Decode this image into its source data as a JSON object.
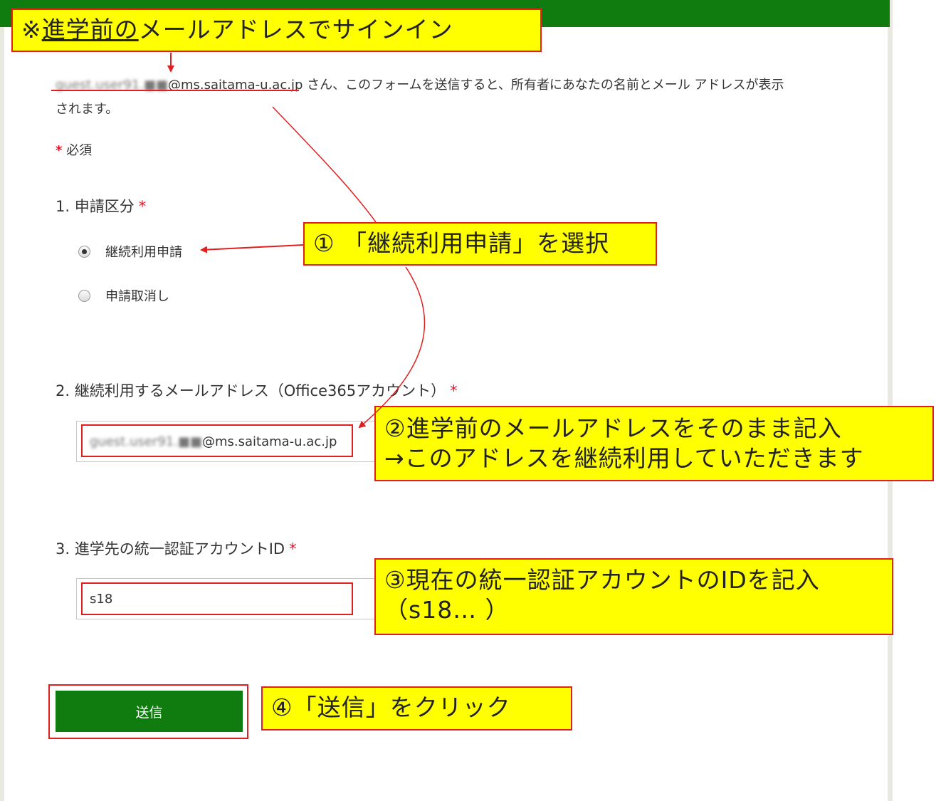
{
  "signin": {
    "email_blurred": "guest.user91.■■",
    "email_domain": "@ms.saitama-u.ac.jp",
    "message_part1": " さん、このフォームを送信すると、所有者にあなたの名前とメール アドレスが表示",
    "message_part2": "されます。"
  },
  "required_note": {
    "star": "*",
    "text": "必須"
  },
  "question1": {
    "title": "1. 申請区分",
    "star": "*",
    "options": [
      {
        "label": "継続利用申請",
        "selected": true
      },
      {
        "label": "申請取消し",
        "selected": false
      }
    ]
  },
  "question2": {
    "title": "2. 継続利用するメールアドレス（Office365アカウント）",
    "star": "*",
    "value_blurred": "guest.user91.■■",
    "value_domain": "@ms.saitama-u.ac.jp"
  },
  "question3": {
    "title": "3. 進学先の統一認証アカウントID",
    "star": "*",
    "value": "s18"
  },
  "submit": {
    "label": "送信"
  },
  "annotations": {
    "top_prefix": "※",
    "top_underlined": "進学前の",
    "top_rest": "メールアドレスでサインイン",
    "step1": "① 「継続利用申請」を選択",
    "step2_line1": "②進学前のメールアドレスをそのまま記入",
    "step2_line2": "→このアドレスを継続利用していただきます",
    "step3_line1": "③現在の統一認証アカウントのIDを記入",
    "step3_line2": "（s18… ）",
    "step4": "④「送信」をクリック"
  },
  "colors": {
    "brand_green": "#107c10",
    "annotation_red": "#e02020",
    "callout_yellow": "#ffff00",
    "required_red": "#e81123"
  }
}
